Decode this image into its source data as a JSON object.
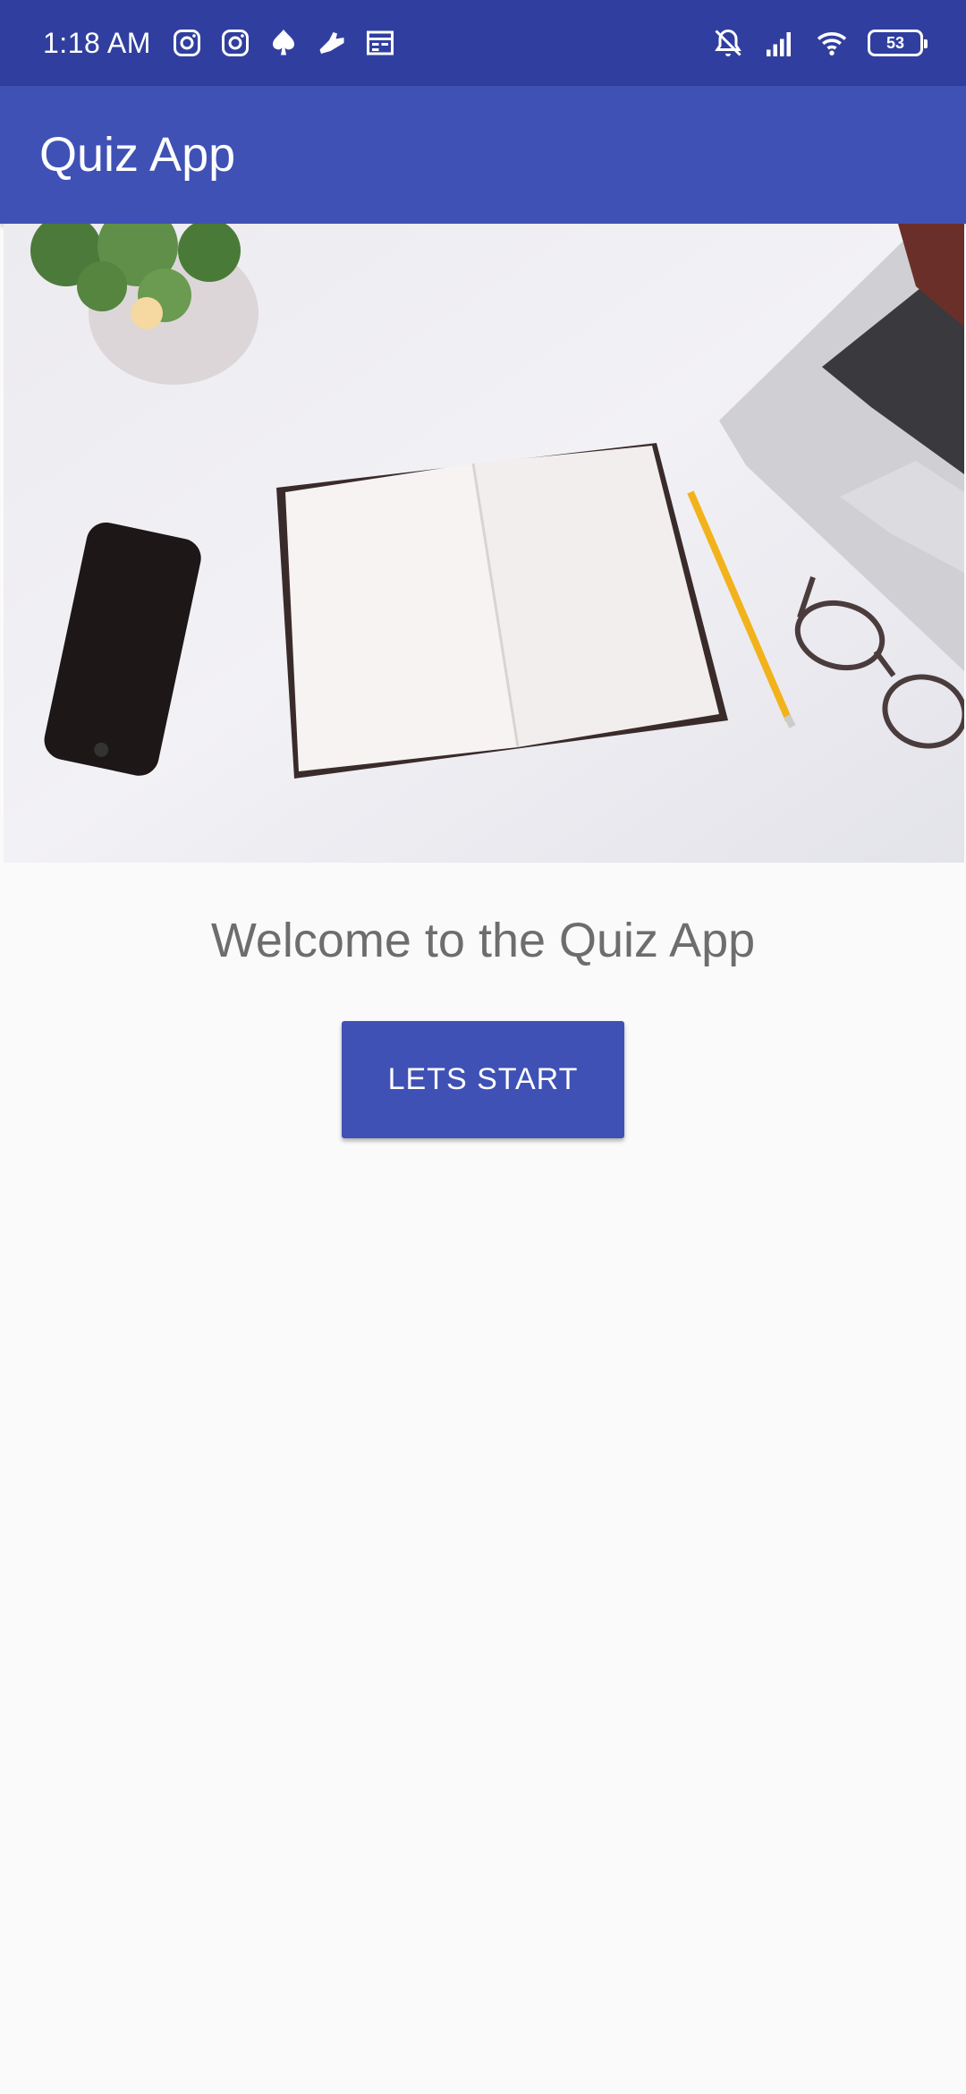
{
  "status_bar": {
    "time": "1:18 AM",
    "left_icons": [
      "instagram-icon",
      "instagram-icon",
      "spade-icon",
      "shoe-icon",
      "calendar-icon"
    ],
    "right_icons": [
      "bell-off-icon",
      "signal-icon",
      "wifi-icon"
    ],
    "battery": "53"
  },
  "app_bar": {
    "title": "Quiz App"
  },
  "hero_image": {
    "description_icon": "desk-workspace-photo"
  },
  "main": {
    "welcome_text": "Welcome to the Quiz App",
    "start_button_label": "LETS START"
  },
  "colors": {
    "primary": "#3f51b5",
    "primary_dark": "#303f9f",
    "background": "#fafafa",
    "text_secondary": "#6d6d6d"
  }
}
